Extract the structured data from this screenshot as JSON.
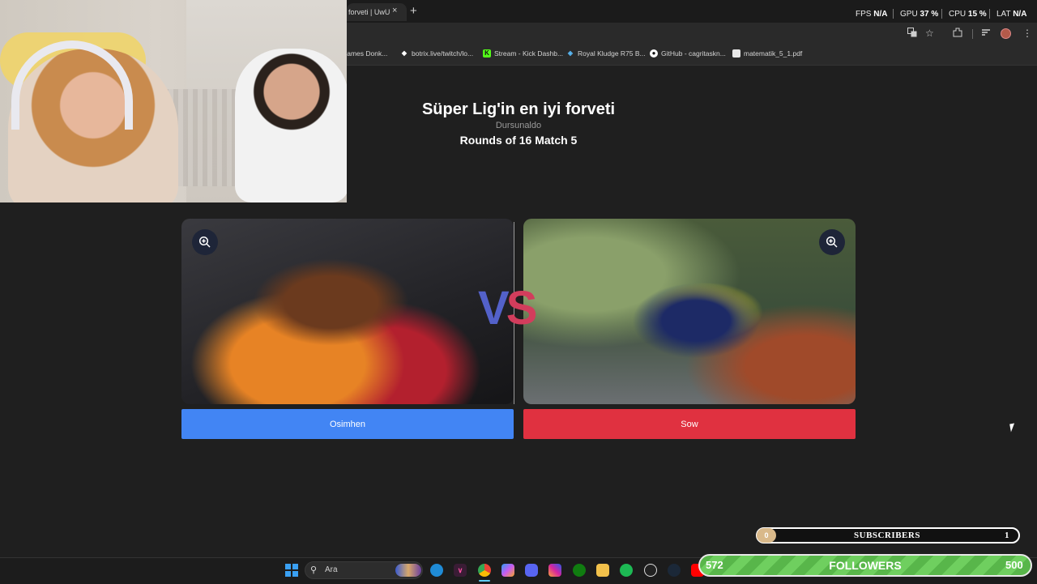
{
  "browser": {
    "tab_title": "forveti | UwU",
    "tab_close": "×",
    "new_tab": "+",
    "toolbar_icons": [
      "translate-icon",
      "star-icon",
      "extensions-icon",
      "tab-search-icon",
      "profile-avatar",
      "more-menu-icon"
    ]
  },
  "perf_overlay": {
    "fps_label": "FPS",
    "fps_value": "N/A",
    "gpu_label": "GPU",
    "gpu_value": "37 %",
    "cpu_label": "CPU",
    "cpu_value": "15 %",
    "lat_label": "LAT",
    "lat_value": "N/A"
  },
  "bookmarks": [
    {
      "label": "James Donk..."
    },
    {
      "label": "botrix.live/twitch/lo..."
    },
    {
      "label": "Stream - Kick Dashb..."
    },
    {
      "label": "Royal Kludge R75 B..."
    },
    {
      "label": "GitHub - cagritaskn..."
    },
    {
      "label": "matematik_5_1.pdf"
    }
  ],
  "page": {
    "title": "Süper Lig'in en iyi forveti",
    "author": "Dursunaldo",
    "round": "Rounds of 16 Match 5",
    "vs_v": "V",
    "vs_s": "S",
    "left_choice": "Osimhen",
    "right_choice": "Sow"
  },
  "stream_widgets": {
    "subs_current": "0",
    "subs_label": "SUBSCRIBERS",
    "subs_goal": "1",
    "followers_current": "572",
    "followers_label": "FOLLOWERS",
    "followers_goal": "500"
  },
  "taskbar": {
    "search_placeholder": "Ara",
    "apps": [
      "edge-icon",
      "clipchamp-icon",
      "chrome-icon",
      "copilot-icon",
      "discord-icon",
      "instagram-icon",
      "xbox-icon",
      "file-explorer-icon",
      "spotify-icon",
      "obs-icon",
      "steam-icon",
      "youtube-icon"
    ]
  },
  "colors": {
    "left_button": "#4285f4",
    "right_button": "#e03140",
    "vs_v": "#5361c9",
    "vs_s": "#d23d5c",
    "followers_bar": "#58b64a"
  }
}
